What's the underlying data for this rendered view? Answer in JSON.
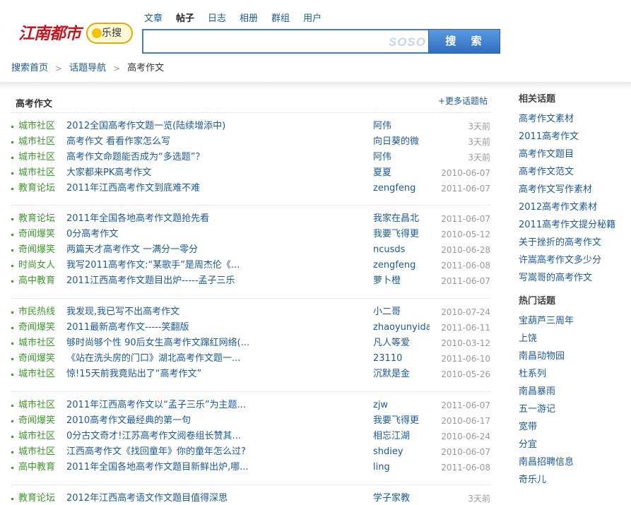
{
  "logo": {
    "main_text": "江南都市",
    "badge_text": "乐搜"
  },
  "tabs": [
    "文章",
    "帖子",
    "日志",
    "相册",
    "群组",
    "用户"
  ],
  "active_tab": "帖子",
  "search": {
    "value": "",
    "watermark": "SOSO",
    "button_label": "搜 索"
  },
  "breadcrumb": {
    "home": "搜索首页",
    "nav": "话题导航",
    "current": "高考作文",
    "separator": ">"
  },
  "main": {
    "title": "高考作文",
    "more_label": "+更多话题帖",
    "groups": [
      [
        {
          "cat": "城市社区",
          "title": "2012全国高考作文题一览(陆续增添中)",
          "author": "阿伟",
          "date": "3天前"
        },
        {
          "cat": "城市社区",
          "title": "高考作文 看看作家怎么写",
          "author": "向日葵的微",
          "date": "3天前"
        },
        {
          "cat": "城市社区",
          "title": "高考作文命题能否成为“多选题”？",
          "author": "阿伟",
          "date": "3天前"
        },
        {
          "cat": "城市社区",
          "title": "大家都来PK高考作文",
          "author": "夏夏",
          "date": "2010-06-07"
        },
        {
          "cat": "教育论坛",
          "title": "2011年江西高考作文到底难不难",
          "author": "zengfeng",
          "date": "2011-06-07"
        }
      ],
      [
        {
          "cat": "教育论坛",
          "title": "2011年全国各地高考作文题抢先看",
          "author": "我家在昌北",
          "date": "2011-06-07"
        },
        {
          "cat": "奇闻爆笑",
          "title": "0分高考作文",
          "author": "我要飞得更",
          "date": "2010-05-12"
        },
        {
          "cat": "奇闻爆笑",
          "title": "两篇天才高考作文 一满分一零分",
          "author": "ncusds",
          "date": "2010-06-28"
        },
        {
          "cat": "时尚女人",
          "title": "我写2011高考作文:“某歌手”是周杰伦《...",
          "author": "zengfeng",
          "date": "2011-06-08"
        },
        {
          "cat": "高中教育",
          "title": "2011江西高考作文题目出炉-----孟子三乐",
          "author": "萝卜橙",
          "date": "2011-06-07"
        }
      ],
      [
        {
          "cat": "市民热线",
          "title": "我发现,我已写不出高考作文",
          "author": "小二哥",
          "date": "2010-07-24"
        },
        {
          "cat": "奇闻爆笑",
          "title": "2011最新高考作文-----笑翻版",
          "author": "zhaoyunyida",
          "date": "2011-06-11"
        },
        {
          "cat": "城市社区",
          "title": "够时尚够个性 90后女生高考作文蹿红网络(...",
          "author": "凡人等爱",
          "date": "2010-03-12"
        },
        {
          "cat": "奇闻爆笑",
          "title": "《站在洗头房的门口》湖北高考作文题一...",
          "author": "23110",
          "date": "2011-06-10"
        },
        {
          "cat": "城市社区",
          "title": "惊!15天前我竟贴出了“高考作文”",
          "author": "沉默是金",
          "date": "2010-05-26"
        }
      ],
      [
        {
          "cat": "城市社区",
          "title": "2011年江西高考作文以“孟子三乐”为主题...",
          "author": "zjw",
          "date": "2011-06-07"
        },
        {
          "cat": "奇闻爆笑",
          "title": "2010高考作文最经典的第一句",
          "author": "我要飞得更",
          "date": "2010-06-17"
        },
        {
          "cat": "城市社区",
          "title": "0分古文奇才!江苏高考作文阅卷组长赞其...",
          "author": "相忘江湖",
          "date": "2010-06-24"
        },
        {
          "cat": "城市社区",
          "title": "江西高考作文《找回童年》你的童年怎么过?",
          "author": "shdiey",
          "date": "2010-06-07"
        },
        {
          "cat": "高中教育",
          "title": "2011年全国各地高考作文题目新鲜出炉,哪...",
          "author": "ling",
          "date": "2011-06-08"
        }
      ],
      [
        {
          "cat": "教育论坛",
          "title": "2012年江西高考语文作文题目值得深思",
          "author": "学子家教",
          "date": "3天前"
        }
      ]
    ]
  },
  "sidebar": {
    "related_title": "相关话题",
    "related": [
      "高考作文素材",
      "2011高考作文",
      "高考作文题目",
      "高考作文范文",
      "高考作文写作素材",
      "2012高考作文素材",
      "2011高考作文提分秘籍",
      "关于挫折的高考作文",
      "许嵩高考作文多少分",
      "写嵩哥的高考作文"
    ],
    "hot_title": "热门话题",
    "hot": [
      "宝葫芦三周年",
      "上饶",
      "南昌动物园",
      "杜系列",
      "南昌暴雨",
      "五一游记",
      "宽带",
      "分宜",
      "南昌招聘信息",
      "奇乐儿"
    ]
  }
}
